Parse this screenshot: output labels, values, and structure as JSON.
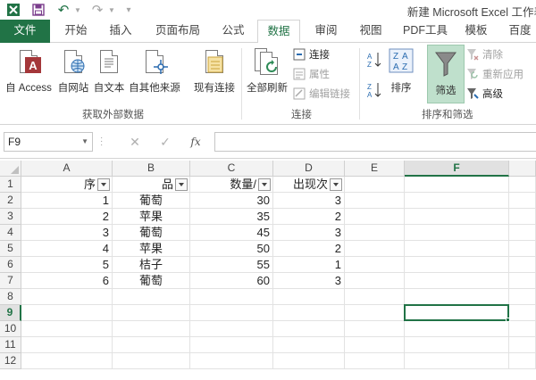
{
  "window": {
    "title": "新建 Microsoft Excel 工作表"
  },
  "tabs": [
    {
      "label": "文件"
    },
    {
      "label": "开始"
    },
    {
      "label": "插入"
    },
    {
      "label": "页面布局"
    },
    {
      "label": "公式"
    },
    {
      "label": "数据"
    },
    {
      "label": "审阅"
    },
    {
      "label": "视图"
    },
    {
      "label": "PDF工具"
    },
    {
      "label": "模板"
    },
    {
      "label": "百度"
    }
  ],
  "active_tab": "数据",
  "ribbon": {
    "external": {
      "group_label": "获取外部数据",
      "access": "自 Access",
      "web": "自网站",
      "text": "自文本",
      "other": "自其他来源",
      "existing": "现有连接"
    },
    "connections": {
      "group_label": "连接",
      "refresh_all": "全部刷新",
      "connections": "连接",
      "properties": "属性",
      "edit_links": "编辑链接"
    },
    "sort_filter": {
      "group_label": "排序和筛选",
      "sort": "排序",
      "filter": "筛选",
      "clear": "清除",
      "reapply": "重新应用",
      "advanced": "高级"
    }
  },
  "formula_bar": {
    "name_box": "F9",
    "fx": "fx",
    "formula": ""
  },
  "colors": {
    "accent": "#217346"
  },
  "sheet": {
    "columns": [
      "A",
      "B",
      "C",
      "D",
      "E",
      "F"
    ],
    "selected_column": "F",
    "rows": [
      "1",
      "2",
      "3",
      "4",
      "5",
      "6",
      "7",
      "8",
      "9",
      "10",
      "11",
      "12"
    ],
    "selected_row": "9",
    "headers": [
      "序",
      "品",
      "数量/",
      "出现次"
    ],
    "data": [
      [
        "1",
        "葡萄",
        "30",
        "3"
      ],
      [
        "2",
        "苹果",
        "35",
        "2"
      ],
      [
        "3",
        "葡萄",
        "45",
        "3"
      ],
      [
        "4",
        "苹果",
        "50",
        "2"
      ],
      [
        "5",
        "桔子",
        "55",
        "1"
      ],
      [
        "6",
        "葡萄",
        "60",
        "3"
      ]
    ]
  }
}
